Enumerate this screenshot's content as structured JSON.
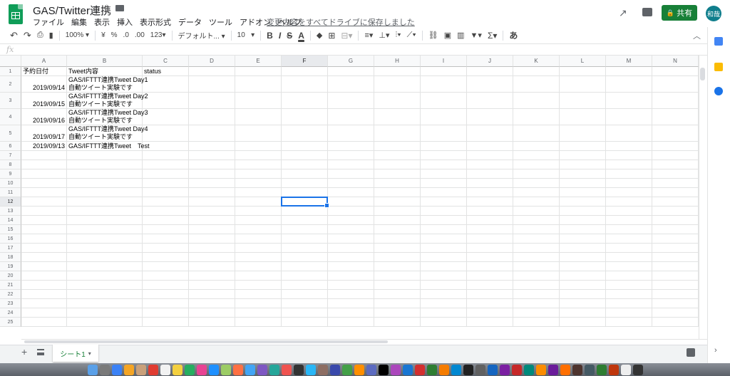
{
  "doc": {
    "title": "GAS/Twitter連携",
    "saved_status": "変更内容をすべてドライブに保存しました"
  },
  "menu": [
    "ファイル",
    "編集",
    "表示",
    "挿入",
    "表示形式",
    "データ",
    "ツール",
    "アドオン",
    "ヘルプ"
  ],
  "header": {
    "share_label": "共有",
    "avatar_text": "和哉"
  },
  "toolbar": {
    "zoom": "100%",
    "currency": "¥",
    "percent": "%",
    "dec_less": ".0",
    "dec_more": ".00",
    "format_more": "123",
    "font": "デフォルト...",
    "font_size": "10",
    "bold": "B",
    "italic": "I",
    "strike": "S",
    "text_color": "A",
    "input_tools": "あ"
  },
  "formula": {
    "fx": "fx",
    "value": ""
  },
  "columns": [
    "A",
    "B",
    "C",
    "D",
    "E",
    "F",
    "G",
    "H",
    "I",
    "J",
    "K",
    "L",
    "M",
    "N"
  ],
  "rows": [
    "1",
    "2",
    "3",
    "4",
    "5",
    "6",
    "7",
    "8",
    "9",
    "10",
    "11",
    "12",
    "13",
    "14",
    "15",
    "16",
    "17",
    "18",
    "19",
    "20",
    "21",
    "22",
    "23",
    "24",
    "25"
  ],
  "cells": {
    "r1": {
      "a": "予約日付",
      "b": "Tweet内容",
      "c": "status"
    },
    "r2": {
      "a": "2019/09/14",
      "b1": "GAS/IFTTT連携Tweet Day1",
      "b2": "自動ツイート実験です"
    },
    "r3": {
      "a": "2019/09/15",
      "b1": "GAS/IFTTT連携Tweet Day2",
      "b2": "自動ツイート実験です"
    },
    "r4": {
      "a": "2019/09/16",
      "b1": "GAS/IFTTT連携Tweet Day3",
      "b2": "自動ツイート実験です"
    },
    "r5": {
      "a": "2019/09/17",
      "b1": "GAS/IFTTT連携Tweet Day4",
      "b2": "自動ツイート実験です"
    },
    "r6": {
      "a": "2019/09/13",
      "b": "GAS/IFTTT連携Tweet　Test"
    }
  },
  "selected_cell": "F12",
  "sheets": [
    {
      "name": "シート1",
      "active": true
    }
  ],
  "colors": {
    "accent": "#188038",
    "selection": "#1a73e8",
    "logo": "#0f9d58"
  }
}
